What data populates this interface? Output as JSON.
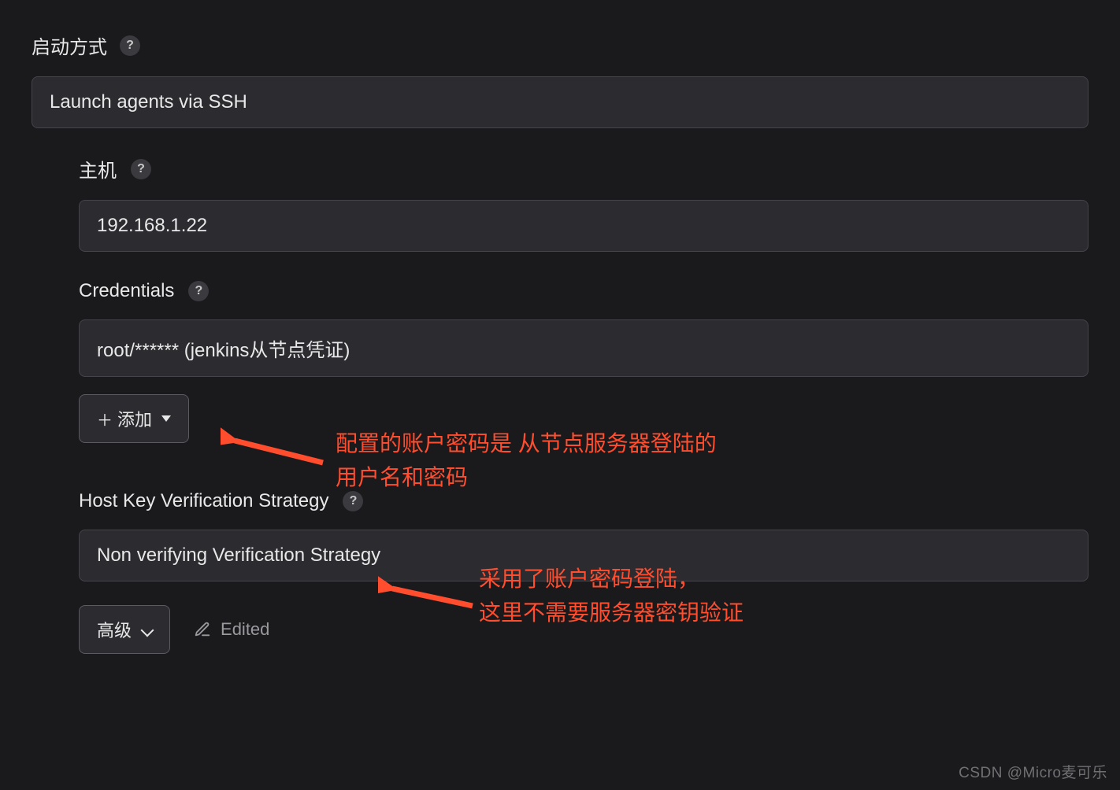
{
  "launchMethod": {
    "label": "启动方式",
    "value": "Launch agents via SSH"
  },
  "host": {
    "label": "主机",
    "value": "192.168.1.22"
  },
  "credentials": {
    "label": "Credentials",
    "value": "root/****** (jenkins从节点凭证)",
    "addButton": "添加"
  },
  "hostKey": {
    "label": "Host Key Verification Strategy",
    "value": "Non verifying Verification Strategy"
  },
  "advancedButton": "高级",
  "editedLabel": "Edited",
  "annotation1": {
    "line1": "配置的账户密码是 从节点服务器登陆的",
    "line2": "用户名和密码"
  },
  "annotation2": {
    "line1": "采用了账户密码登陆，",
    "line2": "这里不需要服务器密钥验证"
  },
  "watermark": "CSDN @Micro麦可乐"
}
